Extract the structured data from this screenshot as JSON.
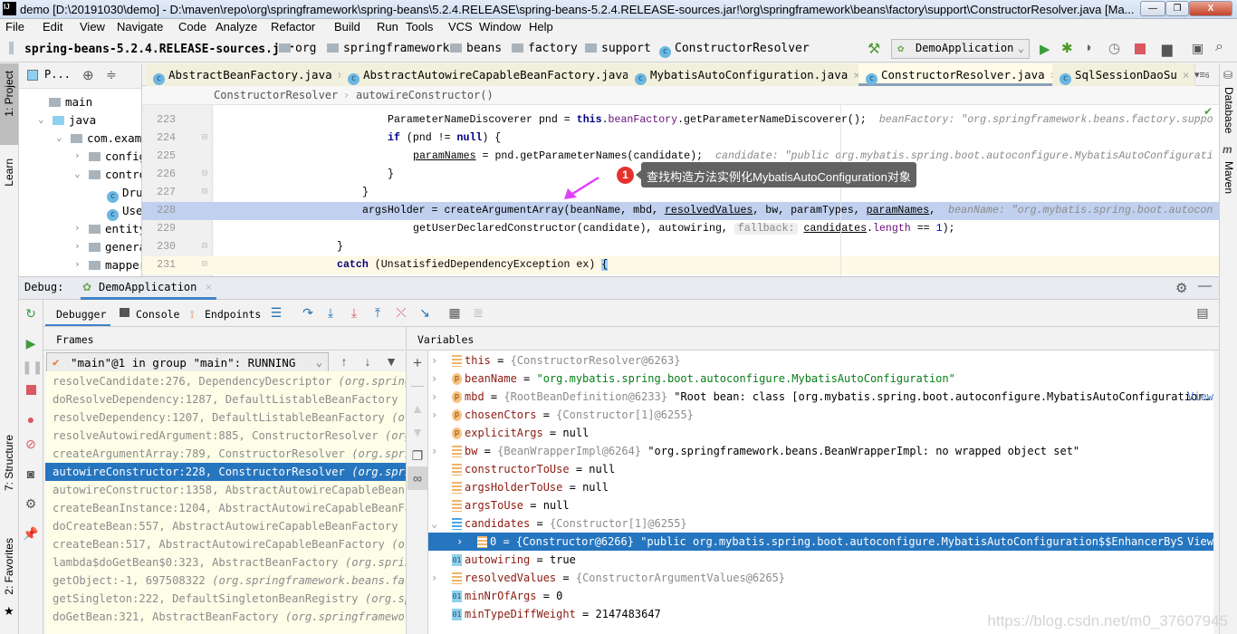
{
  "window": {
    "title": "demo [D:\\20191030\\demo] - D:\\maven\\repo\\org\\springframework\\spring-beans\\5.2.4.RELEASE\\spring-beans-5.2.4.RELEASE-sources.jar!\\org\\springframework\\beans\\factory\\support\\ConstructorResolver.java [Ma...",
    "app_icon": "IJ"
  },
  "menu": [
    "File",
    "Edit",
    "View",
    "Navigate",
    "Code",
    "Analyze",
    "Refactor",
    "Build",
    "Run",
    "Tools",
    "VCS",
    "Window",
    "Help"
  ],
  "nav": {
    "jar": "spring-beans-5.2.4.RELEASE-sources.jar",
    "folders": [
      "org",
      "springframework",
      "beans",
      "factory",
      "support"
    ],
    "class": "ConstructorResolver",
    "run_config": "DemoApplication"
  },
  "left_strip": {
    "project": "1: Project",
    "learn": "Learn",
    "structure": "7: Structure",
    "favorites": "2: Favorites"
  },
  "right_strip": {
    "database": "Database",
    "maven": "Maven"
  },
  "project_panel": {
    "title": "P...",
    "tree": [
      {
        "label": "main",
        "icon": "folder",
        "expanded": true
      },
      {
        "label": "java",
        "icon": "source-folder",
        "expanded": true
      },
      {
        "label": "com.examp",
        "icon": "package",
        "expanded": true
      },
      {
        "label": "config",
        "icon": "package",
        "expanded": false
      },
      {
        "label": "contro",
        "icon": "package",
        "expanded": true
      },
      {
        "label": "Dru",
        "icon": "class"
      },
      {
        "label": "Use",
        "icon": "class"
      },
      {
        "label": "entity",
        "icon": "package",
        "expanded": false
      },
      {
        "label": "genera",
        "icon": "package",
        "expanded": false
      },
      {
        "label": "mapper",
        "icon": "package",
        "expanded": false
      }
    ]
  },
  "tabs": [
    {
      "label": "AbstractBeanFactory.java",
      "active": false
    },
    {
      "label": "AbstractAutowireCapableBeanFactory.java",
      "active": false
    },
    {
      "label": "MybatisAutoConfiguration.java",
      "active": false
    },
    {
      "label": "ConstructorResolver.java",
      "active": true
    },
    {
      "label": "SqlSessionDaoSu",
      "active": false
    }
  ],
  "tabs_overflow": "6",
  "editor_breadcrumb": [
    "ConstructorResolver",
    "autowireConstructor()"
  ],
  "code_lines": [
    {
      "num": "223",
      "tokens": [
        [
          "t",
          "ParameterNameDiscoverer pnd = "
        ],
        [
          "k",
          "this"
        ],
        [
          "t",
          "."
        ],
        [
          "f",
          "beanFactory"
        ],
        [
          "t",
          ".getParameterNameDiscoverer();"
        ]
      ],
      "hint": "beanFactory: \"org.springframework.beans.factory.suppo"
    },
    {
      "num": "224",
      "tokens": [
        [
          "k",
          "if"
        ],
        [
          "t",
          " (pnd != "
        ],
        [
          "k",
          "null"
        ],
        [
          "t",
          ") {"
        ]
      ]
    },
    {
      "num": "225",
      "tokens": [
        [
          "u",
          "paramNames"
        ],
        [
          "t",
          " = pnd.getParameterNames(candidate);"
        ]
      ],
      "hint": "candidate: \"public org.mybatis.spring.boot.autoconfigure.MybatisAutoConfigurati"
    },
    {
      "num": "226",
      "tokens": [
        [
          "t",
          "}"
        ]
      ]
    },
    {
      "num": "227",
      "tokens": [
        [
          "t",
          "}"
        ]
      ]
    },
    {
      "num": "228",
      "tokens": [
        [
          "t",
          "argsHolder = createArgumentArray(beanName, mbd, "
        ],
        [
          "u",
          "resolvedValues"
        ],
        [
          "t",
          ", bw, paramTypes, "
        ],
        [
          "u",
          "paramNames"
        ],
        [
          "t",
          ","
        ]
      ],
      "hint": "beanName: \"org.mybatis.spring.boot.autocon"
    },
    {
      "num": "229",
      "tokens": [
        [
          "t",
          "getUserDeclaredConstructor(candidate), autowiring, "
        ],
        [
          "c",
          "fallback:"
        ],
        [
          "u",
          "candidates"
        ],
        [
          "t",
          "."
        ],
        [
          "f",
          "length"
        ],
        [
          "t",
          " == "
        ],
        [
          "n",
          "1"
        ],
        [
          "t",
          ");"
        ]
      ]
    },
    {
      "num": "230",
      "tokens": [
        [
          "t",
          "}"
        ]
      ]
    },
    {
      "num": "231",
      "tokens": [
        [
          "k",
          "catch"
        ],
        [
          "t",
          " (UnsatisfiedDependencyException ex) "
        ],
        [
          "b",
          "{"
        ]
      ]
    }
  ],
  "annotation": {
    "number": "1",
    "text": "查找构造方法实例化MybatisAutoConfiguration对象",
    "arrow_color": "#e040fb"
  },
  "debug": {
    "label": "Debug:",
    "session": "DemoApplication",
    "subtabs": [
      "Debugger",
      "Console",
      "Endpoints"
    ],
    "frames_header": "Frames",
    "variables_header": "Variables",
    "thread": "\"main\"@1 in group \"main\": RUNNING",
    "frames": [
      {
        "method": "resolveCandidate:276, DependencyDescriptor ",
        "pkg": "(org.springfr"
      },
      {
        "method": "doResolveDependency:1287, DefaultListableBeanFactory ",
        "pkg": "(or"
      },
      {
        "method": "resolveDependency:1207, DefaultListableBeanFactory ",
        "pkg": "(org."
      },
      {
        "method": "resolveAutowiredArgument:885, ConstructorResolver ",
        "pkg": "(org.s"
      },
      {
        "method": "createArgumentArray:789, ConstructorResolver ",
        "pkg": "(org.spring"
      },
      {
        "method": "autowireConstructor:228, ConstructorResolver ",
        "pkg": "(org.spring",
        "selected": true
      },
      {
        "method": "autowireConstructor:1358, AbstractAutowireCapableBeanFac",
        "pkg": ""
      },
      {
        "method": "createBeanInstance:1204, AbstractAutowireCapableBeanFact",
        "pkg": ""
      },
      {
        "method": "doCreateBean:557, AbstractAutowireCapableBeanFactory ",
        "pkg": "(or"
      },
      {
        "method": "createBean:517, AbstractAutowireCapableBeanFactory ",
        "pkg": "(org."
      },
      {
        "method": "lambda$doGetBean$0:323, AbstractBeanFactory ",
        "pkg": "(org.spring"
      },
      {
        "method": "getObject:-1, 697508322 ",
        "pkg": "(org.springframework.beans.facto"
      },
      {
        "method": "getSingleton:222, DefaultSingletonBeanRegistry ",
        "pkg": "(org.spri"
      },
      {
        "method": "doGetBean:321, AbstractBeanFactory ",
        "pkg": "(org.springframework."
      }
    ],
    "variables": [
      {
        "icon": "field",
        "expandable": true,
        "name": "this",
        "ref": "{ConstructorResolver@6263}"
      },
      {
        "icon": "param",
        "expandable": true,
        "name": "beanName",
        "str": "\"org.mybatis.spring.boot.autoconfigure.MybatisAutoConfiguration\""
      },
      {
        "icon": "param",
        "expandable": true,
        "name": "mbd",
        "ref": "{RootBeanDefinition@6233}",
        "val": "\"Root bean: class [org.mybatis.spring.boot.autoconfigure.MybatisAutoConfiguratior…",
        "view": "View"
      },
      {
        "icon": "param",
        "expandable": true,
        "name": "chosenCtors",
        "ref": "{Constructor[1]@6255}"
      },
      {
        "icon": "param",
        "expandable": false,
        "name": "explicitArgs",
        "val": "null"
      },
      {
        "icon": "field",
        "expandable": true,
        "name": "bw",
        "ref": "{BeanWrapperImpl@6264}",
        "val": "\"org.springframework.beans.BeanWrapperImpl: no wrapped object set\""
      },
      {
        "icon": "field",
        "expandable": false,
        "name": "constructorToUse",
        "val": "null"
      },
      {
        "icon": "field",
        "expandable": false,
        "name": "argsHolderToUse",
        "val": "null"
      },
      {
        "icon": "field",
        "expandable": false,
        "name": "argsToUse",
        "val": "null"
      },
      {
        "icon": "array",
        "expandable": true,
        "expanded": true,
        "name": "candidates",
        "ref": "{Constructor[1]@6255}"
      },
      {
        "icon": "field",
        "expandable": true,
        "child": true,
        "selected": true,
        "name": "0",
        "ref": "{Constructor@6266}",
        "val": "\"public org.mybatis.spring.boot.autoconfigure.MybatisAutoConfiguration$$EnhancerBySprir…",
        "view": "View"
      },
      {
        "icon": "primitive",
        "expandable": false,
        "name": "autowiring",
        "val": "true"
      },
      {
        "icon": "field",
        "expandable": true,
        "name": "resolvedValues",
        "ref": "{ConstructorArgumentValues@6265}"
      },
      {
        "icon": "primitive",
        "expandable": false,
        "name": "minNrOfArgs",
        "val": "0"
      },
      {
        "icon": "primitive",
        "expandable": false,
        "name": "minTypeDiffWeight",
        "val": "2147483647"
      }
    ]
  },
  "watermark": "https://blog.csdn.net/m0_37607945"
}
